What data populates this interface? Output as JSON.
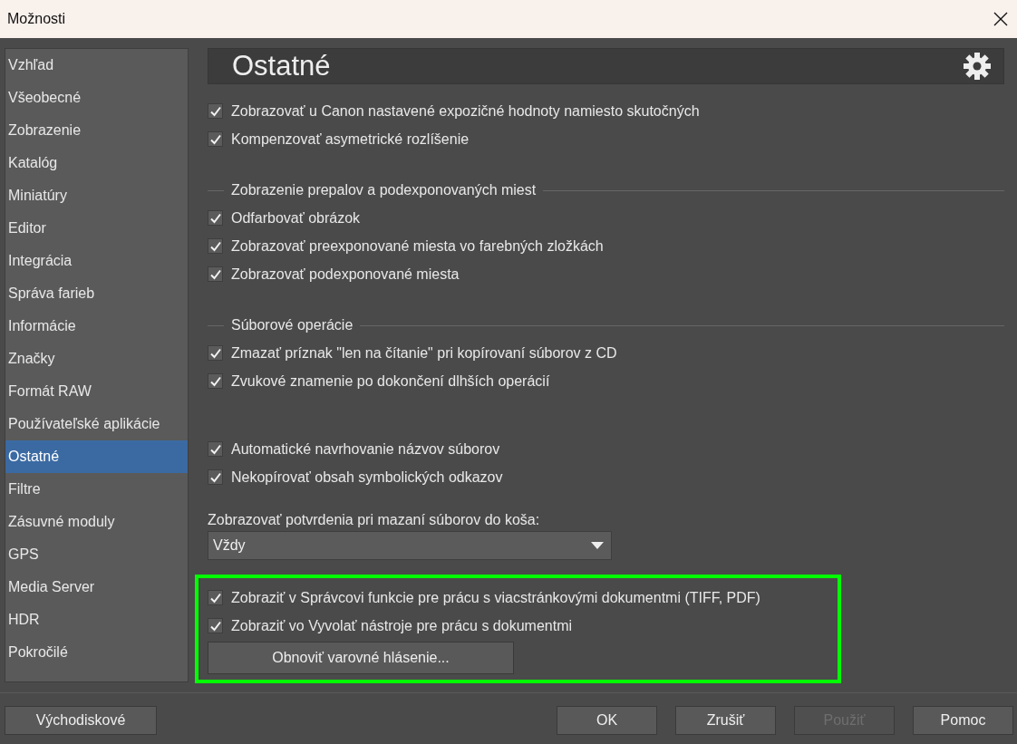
{
  "window": {
    "title": "Možnosti"
  },
  "sidebar": {
    "items": [
      {
        "label": "Vzhľad",
        "selected": false
      },
      {
        "label": "Všeobecné",
        "selected": false
      },
      {
        "label": "Zobrazenie",
        "selected": false
      },
      {
        "label": "Katalóg",
        "selected": false
      },
      {
        "label": "Miniatúry",
        "selected": false
      },
      {
        "label": "Editor",
        "selected": false
      },
      {
        "label": "Integrácia",
        "selected": false
      },
      {
        "label": "Správa farieb",
        "selected": false
      },
      {
        "label": "Informácie",
        "selected": false
      },
      {
        "label": "Značky",
        "selected": false
      },
      {
        "label": "Formát RAW",
        "selected": false
      },
      {
        "label": "Používateľské aplikácie",
        "selected": false
      },
      {
        "label": "Ostatné",
        "selected": true
      },
      {
        "label": "Filtre",
        "selected": false
      },
      {
        "label": "Zásuvné moduly",
        "selected": false
      },
      {
        "label": "GPS",
        "selected": false
      },
      {
        "label": "Media Server",
        "selected": false
      },
      {
        "label": "HDR",
        "selected": false
      },
      {
        "label": "Pokročilé",
        "selected": false
      }
    ]
  },
  "page": {
    "title": "Ostatné"
  },
  "sections": [
    {
      "highlighted": false,
      "items": [
        {
          "kind": "checkbox",
          "label": "Zobrazovať u Canon nastavené expozičné hodnoty namiesto skutočných",
          "checked": true
        },
        {
          "kind": "checkbox",
          "label": "Kompenzovať asymetrické rozlíšenie",
          "checked": true
        }
      ]
    },
    {
      "highlighted": false,
      "heading": "Zobrazenie prepalov a podexponovaných miest",
      "items": [
        {
          "kind": "checkbox",
          "label": "Odfarbovať obrázok",
          "checked": true
        },
        {
          "kind": "checkbox",
          "label": "Zobrazovať preexponované miesta vo farebných zložkách",
          "checked": true
        },
        {
          "kind": "checkbox",
          "label": "Zobrazovať podexponované miesta",
          "checked": true
        }
      ]
    },
    {
      "highlighted": false,
      "heading": "Súborové operácie",
      "items": [
        {
          "kind": "checkbox",
          "label": "Zmazať príznak \"len na čítanie\" pri kopírovaní súborov z CD",
          "checked": true
        },
        {
          "kind": "checkbox",
          "label": "Zvukové znamenie po dokončení dlhších operácií",
          "checked": true
        }
      ]
    },
    {
      "highlighted": false,
      "items": [
        {
          "kind": "checkbox",
          "label": "Automatické navrhovanie názvov súborov",
          "checked": true
        },
        {
          "kind": "checkbox",
          "label": "Nekopírovať obsah symbolických odkazov",
          "checked": true
        }
      ]
    },
    {
      "highlighted": false,
      "items": [
        {
          "kind": "dropdown",
          "label": "Zobrazovať potvrdenia pri mazaní súborov do koša:",
          "value": "Vždy"
        }
      ]
    },
    {
      "highlighted": true,
      "items": [
        {
          "kind": "checkbox",
          "label": "Zobraziť v Správcovi funkcie pre prácu s viacstránkovými dokumentmi (TIFF, PDF)",
          "checked": true
        },
        {
          "kind": "checkbox",
          "label": "Zobraziť vo Vyvolať nástroje pre prácu s dokumentmi",
          "checked": true
        },
        {
          "kind": "button",
          "label": "Obnoviť varovné hlásenie..."
        }
      ]
    }
  ],
  "footer": {
    "left_button": {
      "label": "Východiskové",
      "disabled": false
    },
    "buttons": [
      {
        "label": "OK",
        "disabled": false
      },
      {
        "label": "Zrušiť",
        "disabled": false
      },
      {
        "label": "Použiť",
        "disabled": true
      },
      {
        "label": "Pomoc",
        "disabled": false
      }
    ]
  }
}
